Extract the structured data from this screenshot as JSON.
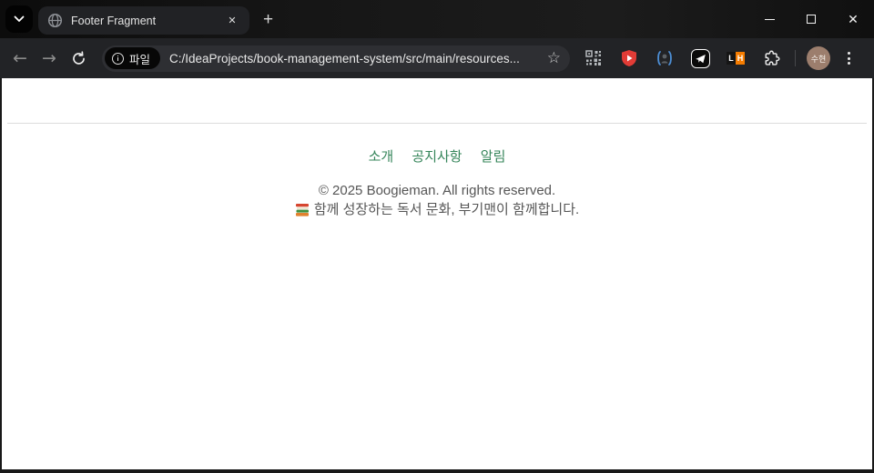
{
  "titlebar": {
    "tab_title": "Footer Fragment"
  },
  "toolbar": {
    "file_chip_label": "파일",
    "url": "C:/IdeaProjects/book-management-system/src/main/resources...",
    "lh_letters": {
      "l": "L",
      "h": "H"
    },
    "profile_initials": "수현"
  },
  "page": {
    "footer": {
      "links": {
        "0": "소개",
        "1": "공지사항",
        "2": "알림"
      },
      "copyright": "© 2025 Boogieman. All rights reserved.",
      "tagline": "함께 성장하는 독서 문화, 부기맨이 함께합니다."
    }
  },
  "colors": {
    "link_green": "#35855a",
    "shield_red": "#e23c36",
    "lh_orange": "#f57c00",
    "avatar_brown": "#9c7e6d"
  }
}
